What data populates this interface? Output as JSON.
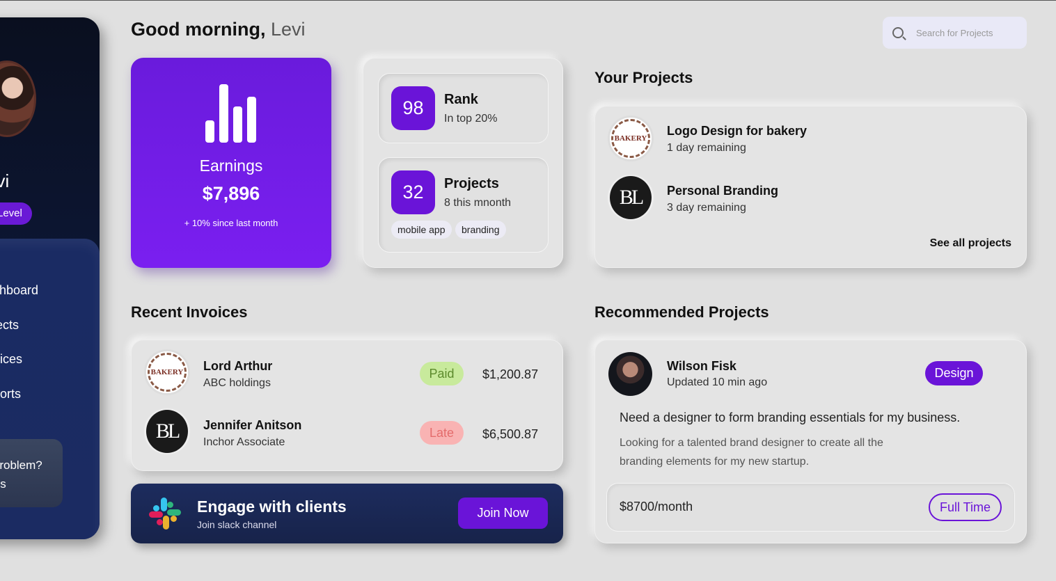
{
  "sidebar": {
    "user_name": "evi",
    "level_label": "Level",
    "nav": [
      "shboard",
      "jects",
      "oices",
      "ports"
    ],
    "help_line1": "Problem?",
    "help_line2": "Us"
  },
  "header": {
    "greeting": "Good morning,",
    "name": "Levi",
    "search_placeholder": "Search for Projects"
  },
  "earnings": {
    "label": "Earnings",
    "value": "$7,896",
    "change": "+ 10% since last month"
  },
  "stats": {
    "rank": {
      "number": "98",
      "title": "Rank",
      "sub": "In top 20%"
    },
    "projects": {
      "number": "32",
      "title": "Projects",
      "sub": "8 this mnonth",
      "tags": [
        "mobile app",
        "branding"
      ]
    }
  },
  "your_projects": {
    "title": "Your Projects",
    "items": [
      {
        "title": "Logo Design for bakery",
        "sub": "1 day remaining",
        "logo": "BAKERY"
      },
      {
        "title": "Personal Branding",
        "sub": "3 day remaining",
        "logo": "BL"
      }
    ],
    "see_all": "See all projects"
  },
  "invoices": {
    "title": "Recent Invoices",
    "rows": [
      {
        "name": "Lord Arthur",
        "company": "ABC holdings",
        "status": "Paid",
        "amount": "$1,200.87",
        "logo": "BAKERY"
      },
      {
        "name": "Jennifer Anitson",
        "company": "Inchor Associate",
        "status": "Late",
        "amount": "$6,500.87",
        "logo": "BL"
      }
    ]
  },
  "slack": {
    "title": "Engage with clients",
    "sub": "Join slack channel",
    "button": "Join Now"
  },
  "recommended": {
    "title": "Recommended Projects",
    "name": "Wilson Fisk",
    "time": "Updated 10 min ago",
    "badge": "Design",
    "headline": "Need a designer to form branding essentials for my business.",
    "desc": "Looking for a talented brand designer to create all the branding elements for my new startup.",
    "salary": "$8700/month",
    "type_button": "Full Time"
  },
  "colors": {
    "accent": "#6a14d8",
    "paid_bg": "#c8ea9c",
    "late_bg": "#f9b3b3",
    "sidebar_bg": "#0c1530"
  }
}
